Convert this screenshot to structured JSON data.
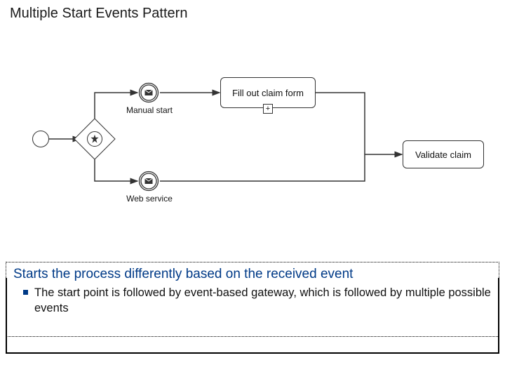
{
  "title": "Multiple Start Events Pattern",
  "diagram": {
    "start_event": "",
    "gateway_type": "event-based",
    "manual_start": {
      "label": "Manual start"
    },
    "web_service": {
      "label": "Web service"
    },
    "fill_task": {
      "label": "Fill out claim form"
    },
    "validate_task": {
      "label": "Validate claim"
    }
  },
  "description": {
    "heading": "Starts the process differently based on the received event",
    "bullet1": "The start point is followed by event-based gateway, which is followed by multiple possible events"
  }
}
